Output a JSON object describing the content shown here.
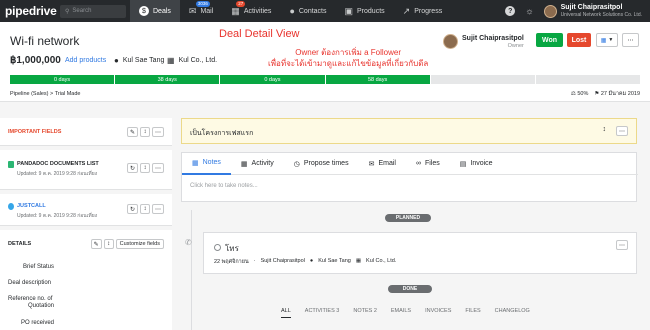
{
  "topnav": {
    "logo": "pipedrive",
    "search_placeholder": "Search",
    "items": [
      {
        "label": "Deals",
        "icon": "dollar-icon",
        "active": true
      },
      {
        "label": "Mail",
        "icon": "mail-icon",
        "badge": "3036"
      },
      {
        "label": "Activities",
        "icon": "calendar-icon",
        "badge": "27"
      },
      {
        "label": "Contacts",
        "icon": "person-icon"
      },
      {
        "label": "Products",
        "icon": "box-icon"
      },
      {
        "label": "Progress",
        "icon": "chart-icon"
      }
    ],
    "help_icon": "?",
    "user": {
      "name": "Sujit Chaiprasitpol",
      "company": "Universal Network Solutions Co. Ltd."
    }
  },
  "deal": {
    "title": "Wi-fi network",
    "value": "฿1,000,000",
    "add_products": "Add products",
    "person": "Kul Sae Tang",
    "org": "Kul Co., Ltd.",
    "owner_name": "Sujit Chaiprasitpol",
    "owner_role": "Owner",
    "won_label": "Won",
    "lost_label": "Lost",
    "stages": [
      "0 days",
      "38 days",
      "0 days",
      "58 days",
      "",
      ""
    ],
    "stages_done": 4,
    "breadcrumb": "Pipeline (Sales)  >  Trial Made",
    "probability": "50%",
    "close_date": "27 มีนาคม 2019"
  },
  "annotation": {
    "title": "Deal Detail View",
    "line1": "Owner ต้องการเพิ่ม a Follower",
    "line2": "เพื่อที่จะได้เข้ามาดูและแก้ไขข้อมูลที่เกี่ยวกับดีล"
  },
  "sidebar": {
    "important_fields": "IMPORTANT FIELDS",
    "pandadoc_title": "PANDADOC DOCUMENTS LIST",
    "pandadoc_updated": "Updated: 9 ต.ค. 2019 9:28 ก่อนเที่ยง",
    "justcall_title": "JUSTCALL",
    "justcall_updated": "Updated: 9 ต.ค. 2019 9:28 ก่อนเที่ยง",
    "details_title": "DETAILS",
    "customize": "Customize fields",
    "detail_rows": [
      "Brief Status",
      "Deal description",
      "Reference no. of",
      "Quotation",
      "PO received"
    ]
  },
  "main": {
    "notice": "เป็นโครงการเฟสแรก",
    "tabs": [
      {
        "label": "Notes",
        "icon": "note-icon"
      },
      {
        "label": "Activity",
        "icon": "calendar-icon"
      },
      {
        "label": "Propose times",
        "icon": "clock-icon"
      },
      {
        "label": "Email",
        "icon": "mail-icon"
      },
      {
        "label": "Files",
        "icon": "paperclip-icon"
      },
      {
        "label": "Invoice",
        "icon": "invoice-icon"
      }
    ],
    "notes_placeholder": "Click here to take notes...",
    "planned": "PLANNED",
    "activity_title": "โทร",
    "activity_date": "22 พฤศจิกายน",
    "activity_owner": "Sujit Chaiprasitpol",
    "activity_person": "Kul Sae Tang",
    "activity_org": "Kul Co., Ltd.",
    "done": "DONE",
    "filters": [
      "ALL",
      "ACTIVITIES",
      "NOTES",
      "EMAILS",
      "INVOICES",
      "FILES",
      "CHANGELOG"
    ],
    "filter_counts": [
      "",
      "3",
      "2",
      "",
      "",
      "",
      ""
    ]
  },
  "colors": {
    "won": "#08a742",
    "lost": "#e5482d",
    "accent": "#317ae2",
    "nav": "#26292c"
  }
}
